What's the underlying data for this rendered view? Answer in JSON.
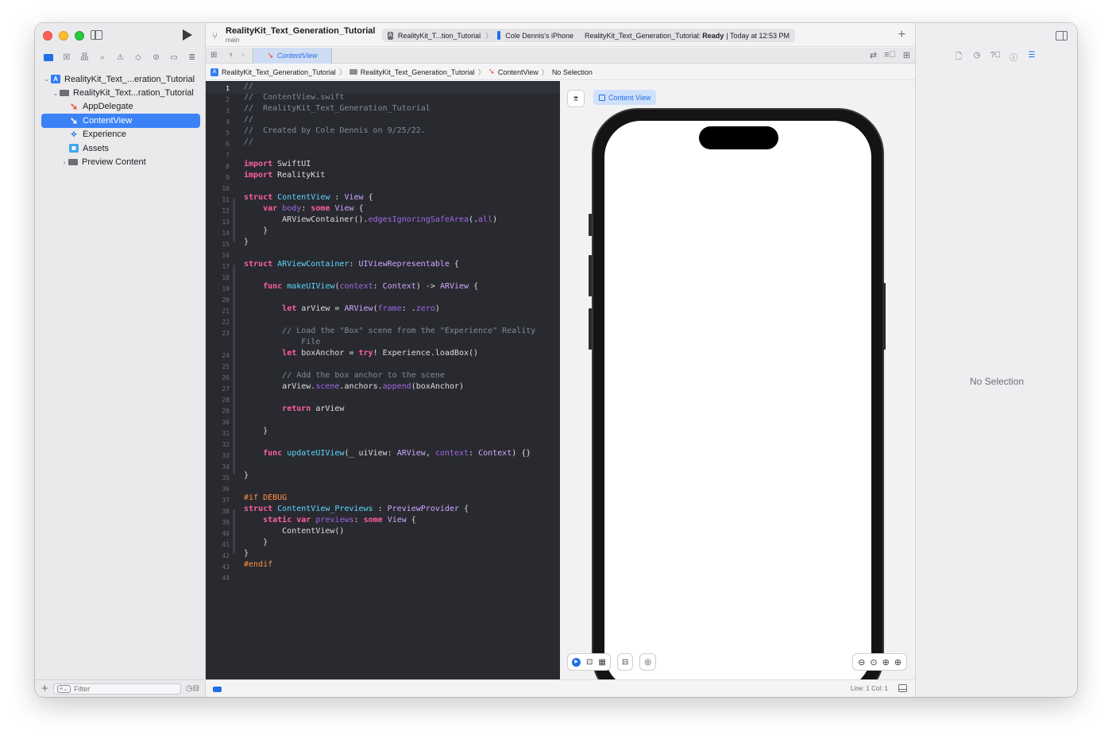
{
  "window": {
    "colors": {
      "accent": "#1f6fe5",
      "swift_orange": "#f05138",
      "editor_bg": "#292a30"
    }
  },
  "navigator": {
    "tabs": [
      "folder-icon",
      "source-control-icon",
      "symbol-icon",
      "search-icon",
      "issue-icon",
      "test-icon",
      "debug-icon",
      "breakpoint-icon",
      "report-icon"
    ],
    "tree": [
      {
        "label": "RealityKit_Text_...eration_Tutorial",
        "icon": "project-icon",
        "depth": 0,
        "expanded": true
      },
      {
        "label": "RealityKit_Text...ration_Tutorial",
        "icon": "group-folder-icon",
        "depth": 1,
        "expanded": true
      },
      {
        "label": "AppDelegate",
        "icon": "swift-file-icon",
        "depth": 2
      },
      {
        "label": "ContentView",
        "icon": "swift-file-icon",
        "depth": 2,
        "selected": true
      },
      {
        "label": "Experience",
        "icon": "reality-file-icon",
        "depth": 2
      },
      {
        "label": "Assets",
        "icon": "asset-catalog-icon",
        "depth": 2
      },
      {
        "label": "Preview Content",
        "icon": "group-folder-icon",
        "depth": 2,
        "expanded": false
      }
    ],
    "filter_placeholder": "Filter"
  },
  "toolbar": {
    "project_title": "RealityKit_Text_Generation_Tutorial",
    "branch": "main",
    "scheme": "RealityKit_T...tion_Tutorial",
    "device": "Cole Dennis's iPhone",
    "status_prefix": "RealityKit_Text_Generation_Tutorial:",
    "status_state": "Ready",
    "status_time": "| Today at 12:53 PM"
  },
  "tabbar": {
    "active_tab": "ContentView"
  },
  "jumpbar": {
    "project": "RealityKit_Text_Generation_Tutorial",
    "group": "RealityKit_Text_Generation_Tutorial",
    "file": "ContentView",
    "symbol": "No Selection"
  },
  "editor": {
    "current_line": 1,
    "line_count": 44
  },
  "canvas": {
    "preview_label": "Content View"
  },
  "statusbar": {
    "line_col": "Line: 1  Col: 1"
  },
  "inspector": {
    "empty_text": "No Selection"
  }
}
